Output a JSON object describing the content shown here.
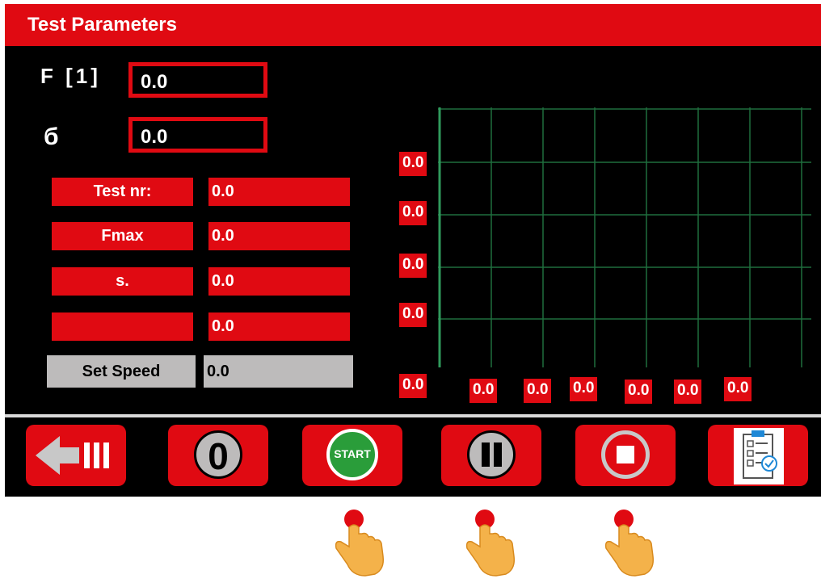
{
  "title": "Test Parameters",
  "force": {
    "label": "F [1]",
    "value": "0.0"
  },
  "stress": {
    "label": "б",
    "value": "0.0"
  },
  "params": [
    {
      "label": "Test nr:",
      "value": "0.0"
    },
    {
      "label": "Fmax",
      "value": "0.0"
    },
    {
      "label": "s.",
      "value": "0.0"
    },
    {
      "label": "",
      "value": "0.0"
    }
  ],
  "set_speed": {
    "label": "Set Speed",
    "value": "0.0"
  },
  "graph": {
    "y_labels": [
      "0.0",
      "0.0",
      "0.0",
      "0.0"
    ],
    "origin_label": "0.0",
    "x_labels": [
      "0.0",
      "0.0",
      "0.0",
      "0.0",
      "0.0",
      "0.0"
    ]
  },
  "buttons": {
    "back_icon": "back-arrow-icon",
    "zero_label": "0",
    "start_label": "START",
    "pause_icon": "pause-icon",
    "stop_icon": "stop-icon",
    "report_icon": "clipboard-checklist-icon"
  },
  "hints": {
    "icon": "tap-finger-icon",
    "count": 3
  },
  "colors": {
    "accent": "#e00a12",
    "background": "#000000",
    "grid": "#1f6e3d",
    "start": "#2a9d3a",
    "neutral": "#bdbbbb"
  }
}
